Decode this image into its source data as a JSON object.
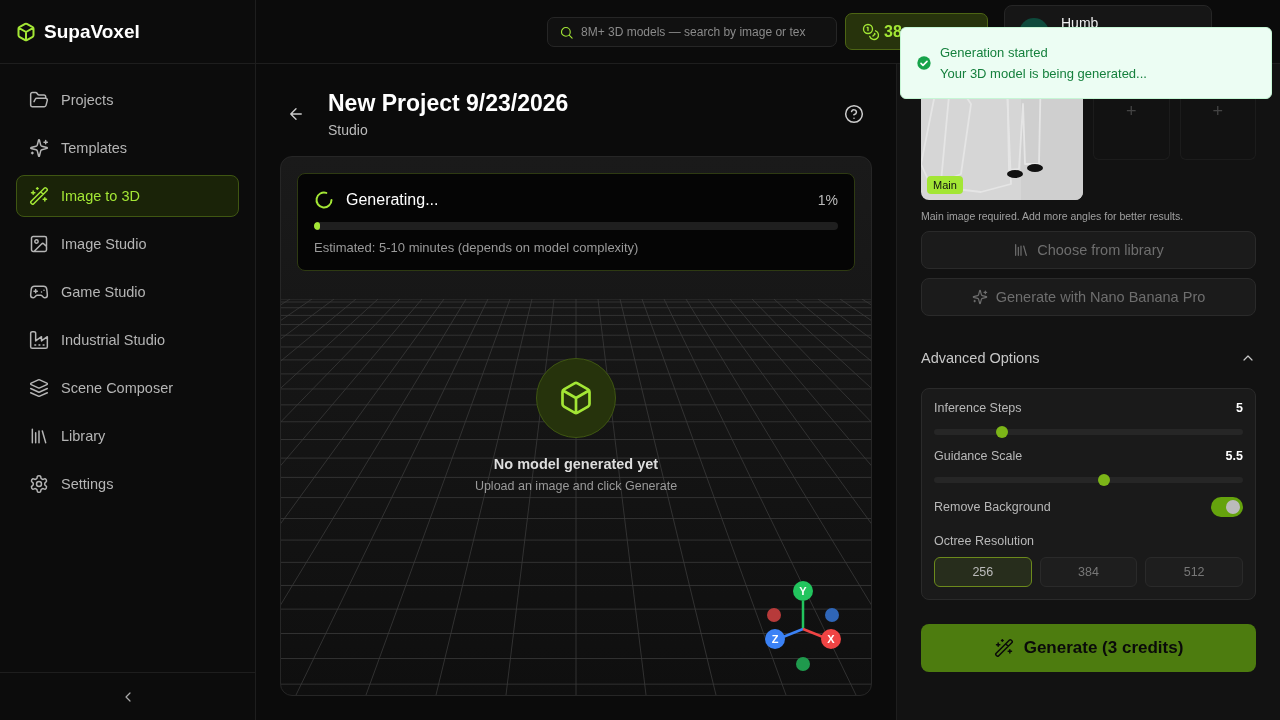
{
  "app": {
    "name": "SupaVoxel"
  },
  "sidebar": {
    "items": [
      {
        "label": "Projects",
        "selected": false
      },
      {
        "label": "Templates",
        "selected": false
      },
      {
        "label": "Image to 3D",
        "selected": true
      },
      {
        "label": "Image Studio",
        "selected": false
      },
      {
        "label": "Game Studio",
        "selected": false
      },
      {
        "label": "Industrial Studio",
        "selected": false
      },
      {
        "label": "Scene Composer",
        "selected": false
      },
      {
        "label": "Library",
        "selected": false
      },
      {
        "label": "Settings",
        "selected": false
      }
    ]
  },
  "header": {
    "search": {
      "placeholder": "8M+ 3D models — search by image or tex"
    },
    "credits": "38",
    "user": "Humb"
  },
  "toast": {
    "title": "Generation started",
    "message": "Your 3D model is being generated..."
  },
  "project": {
    "title": "New Project 9/23/2026",
    "subtitle": "Studio"
  },
  "progress": {
    "status": "Generating...",
    "percent": "1%",
    "level": 0.01,
    "note": "Estimated: 5-10 minutes (depends on model complexity)"
  },
  "viewport": {
    "empty_title": "No model generated yet",
    "empty_hint": "Upload an image and click Generate",
    "gizmo": [
      "Y",
      "Z",
      "X"
    ]
  },
  "images": [
    {
      "kind": "picture",
      "badge": "Main"
    },
    {
      "kind": "empty",
      "glyph": "+"
    },
    {
      "kind": "empty",
      "glyph": "+"
    }
  ],
  "images_hint": "Main image required. Add more angles for better results.",
  "actions": [
    {
      "label": "Choose from library",
      "disabled": true
    },
    {
      "label": "Generate with Nano Banana Pro",
      "disabled": true
    }
  ],
  "advanced": {
    "title": "Advanced Options",
    "expanded": true,
    "settings": [
      {
        "kind": "slider",
        "label": "Inference Steps",
        "value": "5",
        "level": 0.22
      },
      {
        "kind": "slider",
        "label": "Guidance Scale",
        "value": "5.5",
        "level": 0.55
      },
      {
        "kind": "toggle",
        "label": "Remove Background",
        "on": true
      },
      {
        "kind": "choice",
        "label": "Octree Resolution",
        "options": [
          {
            "label": "256",
            "selected": true
          },
          {
            "label": "384",
            "selected": false
          },
          {
            "label": "512",
            "selected": false
          }
        ]
      }
    ]
  },
  "generate_button": "Generate (3 credits)"
}
